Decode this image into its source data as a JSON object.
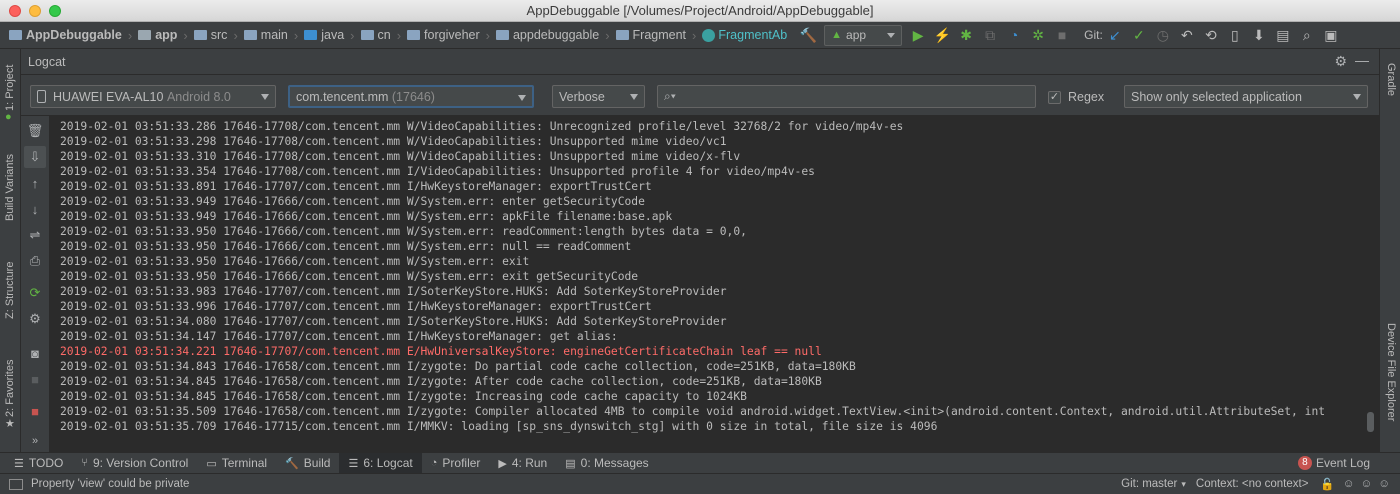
{
  "window": {
    "title": "AppDebuggable [/Volumes/Project/Android/AppDebuggable]"
  },
  "breadcrumbs": [
    "AppDebuggable",
    "app",
    "src",
    "main",
    "java",
    "cn",
    "forgiveher",
    "appdebuggable",
    "Fragment",
    "FragmentAb"
  ],
  "toolbar": {
    "run_config": "app",
    "git_label": "Git:"
  },
  "logcat": {
    "title": "Logcat",
    "device": "HUAWEI EVA-AL10",
    "device_version": "Android 8.0",
    "process": "com.tencent.mm",
    "process_pid": "(17646)",
    "level": "Verbose",
    "search_placeholder": "",
    "regex_label": "Regex",
    "regex_checked": true,
    "filter": "Show only selected application",
    "lines": [
      {
        "text": "2019-02-01 03:51:33.286 17646-17708/com.tencent.mm W/VideoCapabilities: Unrecognized profile/level 32768/2 for video/mp4v-es",
        "level": "W"
      },
      {
        "text": "2019-02-01 03:51:33.298 17646-17708/com.tencent.mm W/VideoCapabilities: Unsupported mime video/vc1",
        "level": "W"
      },
      {
        "text": "2019-02-01 03:51:33.310 17646-17708/com.tencent.mm W/VideoCapabilities: Unsupported mime video/x-flv",
        "level": "W"
      },
      {
        "text": "2019-02-01 03:51:33.354 17646-17708/com.tencent.mm I/VideoCapabilities: Unsupported profile 4 for video/mp4v-es",
        "level": "I"
      },
      {
        "text": "2019-02-01 03:51:33.891 17646-17707/com.tencent.mm I/HwKeystoreManager: exportTrustCert",
        "level": "I"
      },
      {
        "text": "2019-02-01 03:51:33.949 17646-17666/com.tencent.mm W/System.err: enter getSecurityCode",
        "level": "W"
      },
      {
        "text": "2019-02-01 03:51:33.949 17646-17666/com.tencent.mm W/System.err: apkFile filename:base.apk",
        "level": "W"
      },
      {
        "text": "2019-02-01 03:51:33.950 17646-17666/com.tencent.mm W/System.err: readComment:length bytes data = 0,0,",
        "level": "W"
      },
      {
        "text": "2019-02-01 03:51:33.950 17646-17666/com.tencent.mm W/System.err: null == readComment",
        "level": "W"
      },
      {
        "text": "2019-02-01 03:51:33.950 17646-17666/com.tencent.mm W/System.err: exit",
        "level": "W"
      },
      {
        "text": "2019-02-01 03:51:33.950 17646-17666/com.tencent.mm W/System.err: exit getSecurityCode",
        "level": "W"
      },
      {
        "text": "2019-02-01 03:51:33.983 17646-17707/com.tencent.mm I/SoterKeyStore.HUKS: Add SoterKeyStoreProvider",
        "level": "I"
      },
      {
        "text": "2019-02-01 03:51:33.996 17646-17707/com.tencent.mm I/HwKeystoreManager: exportTrustCert",
        "level": "I"
      },
      {
        "text": "2019-02-01 03:51:34.080 17646-17707/com.tencent.mm I/SoterKeyStore.HUKS: Add SoterKeyStoreProvider",
        "level": "I"
      },
      {
        "text": "2019-02-01 03:51:34.147 17646-17707/com.tencent.mm I/HwKeystoreManager: get alias:",
        "level": "I"
      },
      {
        "text": "2019-02-01 03:51:34.221 17646-17707/com.tencent.mm E/HwUniversalKeyStore: engineGetCertificateChain leaf == null",
        "level": "E"
      },
      {
        "text": "2019-02-01 03:51:34.843 17646-17658/com.tencent.mm I/zygote: Do partial code cache collection, code=251KB, data=180KB",
        "level": "I"
      },
      {
        "text": "2019-02-01 03:51:34.845 17646-17658/com.tencent.mm I/zygote: After code cache collection, code=251KB, data=180KB",
        "level": "I"
      },
      {
        "text": "2019-02-01 03:51:34.845 17646-17658/com.tencent.mm I/zygote: Increasing code cache capacity to 1024KB",
        "level": "I"
      },
      {
        "text": "2019-02-01 03:51:35.509 17646-17658/com.tencent.mm I/zygote: Compiler allocated 4MB to compile void android.widget.TextView.<init>(android.content.Context, android.util.AttributeSet, int",
        "level": "I"
      },
      {
        "text": "2019-02-01 03:51:35.709 17646-17715/com.tencent.mm I/MMKV: loading [sp_sns_dynswitch_stg] with 0 size in total, file size is 4096",
        "level": "I"
      }
    ]
  },
  "left_tabs": [
    "1: Project",
    "Build Variants",
    "Z: Structure",
    "2: Favorites"
  ],
  "right_tabs": [
    "Gradle",
    "Device File Explorer"
  ],
  "bottom_tabs": [
    {
      "label": "TODO"
    },
    {
      "label": "9: Version Control"
    },
    {
      "label": "Terminal"
    },
    {
      "label": "Build"
    },
    {
      "label": "6: Logcat"
    },
    {
      "label": "Profiler"
    },
    {
      "label": "4: Run"
    },
    {
      "label": "0: Messages"
    }
  ],
  "event_log": {
    "count": "8",
    "label": "Event Log"
  },
  "status": {
    "message": "Property 'view' could be private",
    "git": "Git: master",
    "context": "Context: <no context>"
  },
  "colors": {
    "error": "#ff6b68",
    "accent": "#3d8fd1",
    "bg_log": "#2b2b2b",
    "panel": "#3c3f41"
  }
}
